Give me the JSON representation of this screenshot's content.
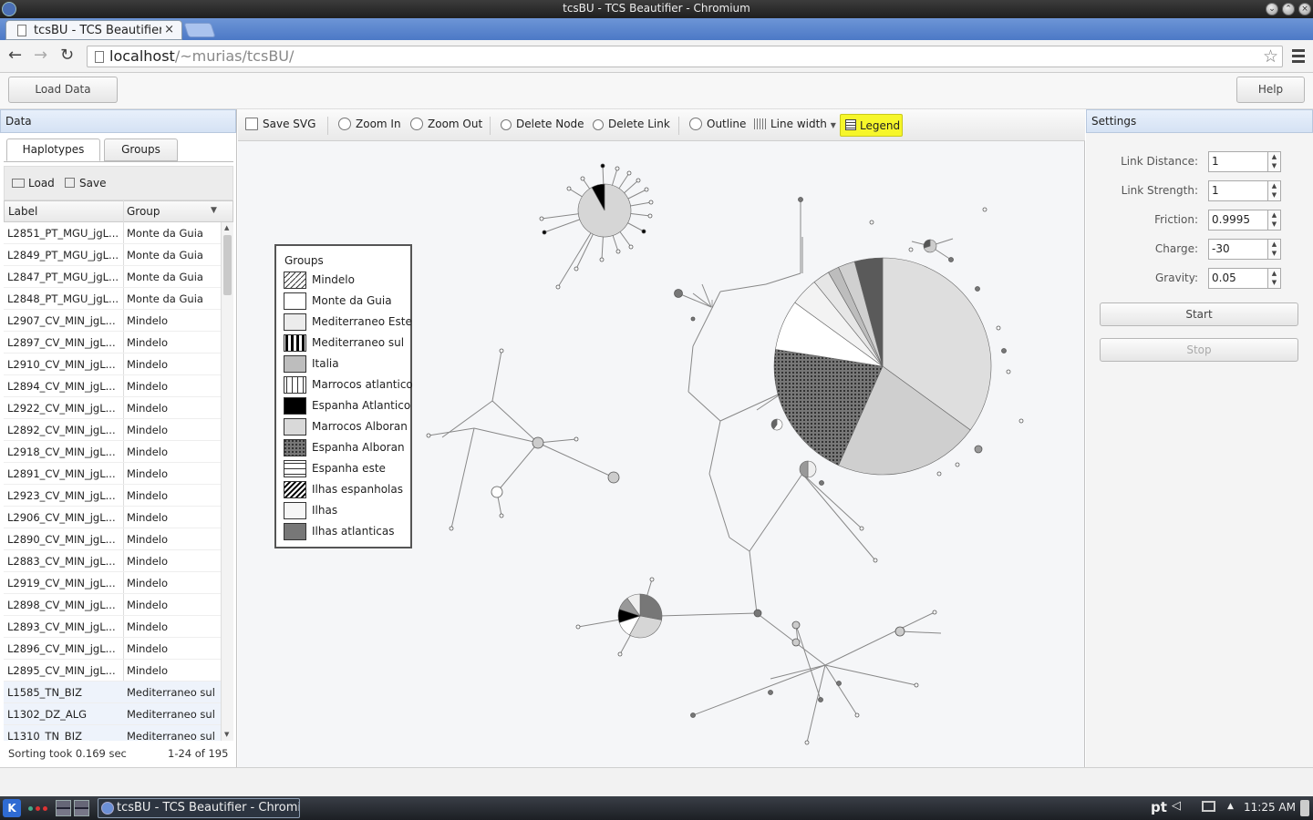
{
  "window": {
    "title": "tcsBU - TCS Beautifier - Chromium"
  },
  "browser": {
    "tab_title": "tcsBU - TCS Beautifier",
    "tab_close": "×",
    "url_host": "localhost",
    "url_path": "/~murias/tcsBU/",
    "star": "☆"
  },
  "app": {
    "load_data": "Load Data",
    "help": "Help"
  },
  "data_panel": {
    "title": "Data",
    "tabs": [
      "Haplotypes",
      "Groups"
    ],
    "load": "Load",
    "save": "Save",
    "columns": [
      "Label",
      "Group"
    ],
    "rows": [
      [
        "L2851_PT_MGU_jgL...",
        "Monte da Guia"
      ],
      [
        "L2849_PT_MGU_jgL...",
        "Monte da Guia"
      ],
      [
        "L2847_PT_MGU_jgL...",
        "Monte da Guia"
      ],
      [
        "L2848_PT_MGU_jgL...",
        "Monte da Guia"
      ],
      [
        "L2907_CV_MIN_jgL...",
        "Mindelo"
      ],
      [
        "L2897_CV_MIN_jgL...",
        "Mindelo"
      ],
      [
        "L2910_CV_MIN_jgL...",
        "Mindelo"
      ],
      [
        "L2894_CV_MIN_jgL...",
        "Mindelo"
      ],
      [
        "L2922_CV_MIN_jgL...",
        "Mindelo"
      ],
      [
        "L2892_CV_MIN_jgL...",
        "Mindelo"
      ],
      [
        "L2918_CV_MIN_jgL...",
        "Mindelo"
      ],
      [
        "L2891_CV_MIN_jgL...",
        "Mindelo"
      ],
      [
        "L2923_CV_MIN_jgL...",
        "Mindelo"
      ],
      [
        "L2906_CV_MIN_jgL...",
        "Mindelo"
      ],
      [
        "L2890_CV_MIN_jgL...",
        "Mindelo"
      ],
      [
        "L2883_CV_MIN_jgL...",
        "Mindelo"
      ],
      [
        "L2919_CV_MIN_jgL...",
        "Mindelo"
      ],
      [
        "L2898_CV_MIN_jgL...",
        "Mindelo"
      ],
      [
        "L2893_CV_MIN_jgL...",
        "Mindelo"
      ],
      [
        "L2896_CV_MIN_jgL...",
        "Mindelo"
      ],
      [
        "L2895_CV_MIN_jgL...",
        "Mindelo"
      ],
      [
        "L1585_TN_BIZ",
        "Mediterraneo sul"
      ],
      [
        "L1302_DZ_ALG",
        "Mediterraneo sul"
      ],
      [
        "L1310_TN_BIZ",
        "Mediterraneo sul"
      ]
    ],
    "status": "Sorting took 0.169 sec",
    "paging": "1-24 of 195"
  },
  "canvas_toolbar": {
    "save_svg": "Save SVG",
    "zoom_in": "Zoom In",
    "zoom_out": "Zoom Out",
    "delete_node": "Delete Node",
    "delete_link": "Delete Link",
    "outline": "Outline",
    "line_width": "Line width",
    "legend": "Legend"
  },
  "legend": {
    "title": "Groups",
    "items": [
      "Mindelo",
      "Monte da Guia",
      "Mediterraneo Este",
      "Mediterraneo sul",
      "Italia",
      "Marrocos atlantico",
      "Espanha Atlantico",
      "Marrocos Alboran",
      "Espanha Alboran",
      "Espanha este",
      "Ilhas espanholas",
      "Ilhas",
      "Ilhas atlanticas"
    ]
  },
  "settings": {
    "title": "Settings",
    "fields": [
      {
        "label": "Link Distance:",
        "value": "1"
      },
      {
        "label": "Link Strength:",
        "value": "1"
      },
      {
        "label": "Friction:",
        "value": "0.9995"
      },
      {
        "label": "Charge:",
        "value": "-30"
      },
      {
        "label": "Gravity:",
        "value": "0.05"
      }
    ],
    "start": "Start",
    "stop": "Stop"
  },
  "taskbar": {
    "item": "tcsBU - TCS Beautifier - Chromium",
    "lang": "pt",
    "clock": "11:25 AM"
  }
}
